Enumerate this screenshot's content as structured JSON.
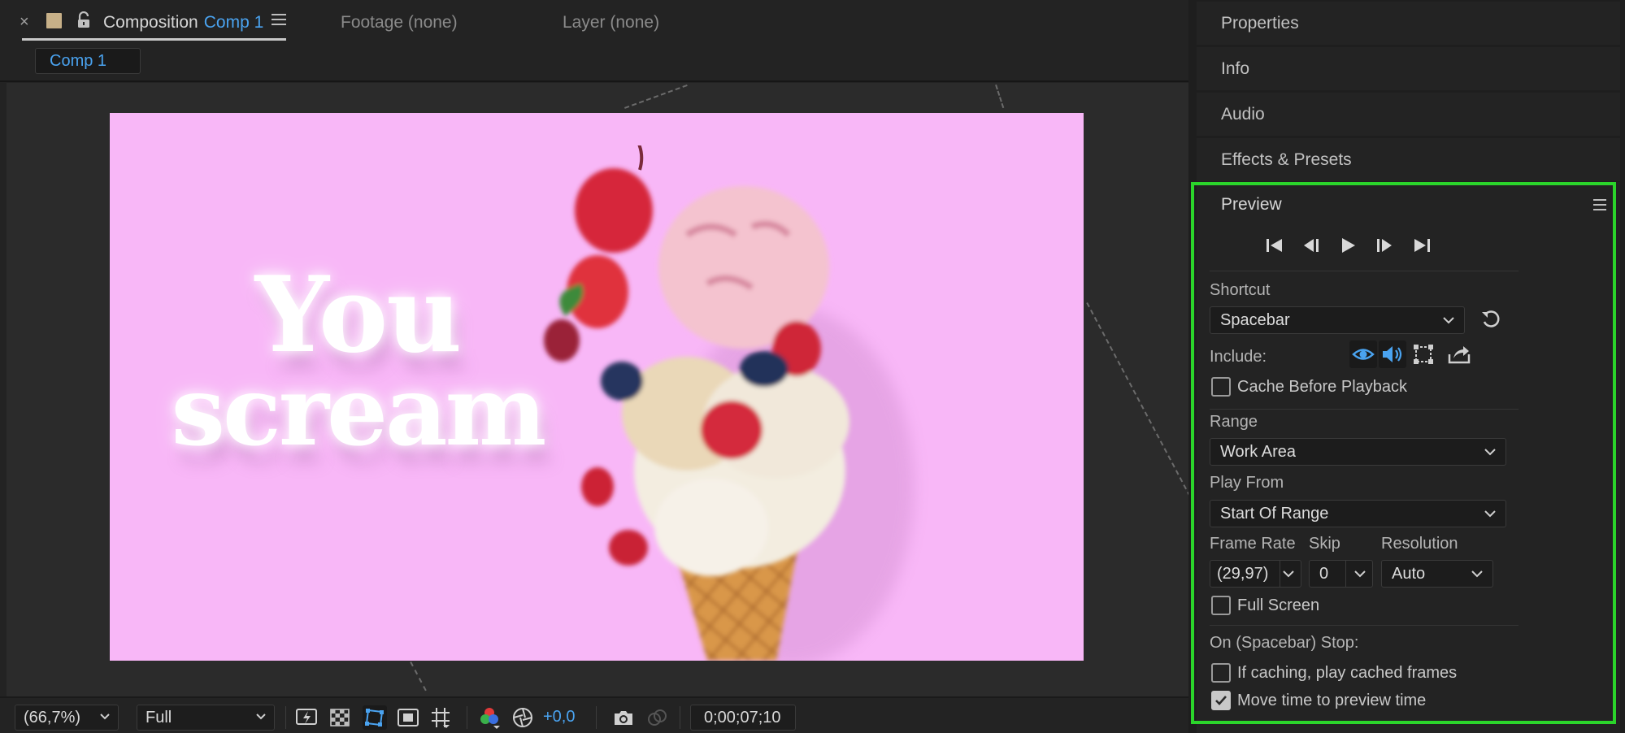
{
  "composition_panel": {
    "tabs": [
      {
        "prefix": "Composition",
        "accent": "Comp 1"
      },
      {
        "label": "Footage (none)"
      },
      {
        "label": "Layer (none)"
      }
    ],
    "breadcrumb": "Comp 1",
    "canvas_text": {
      "line1": "You",
      "line2": "scream"
    },
    "toolbar": {
      "magnification": "(66,7%)",
      "resolution": "Full",
      "exposure": "+0,0",
      "timecode": "0;00;07;10"
    },
    "colors": {
      "accent": "#4aa3f0",
      "canvas_background": "#f8b7f7"
    }
  },
  "right_panels": {
    "collapsed": [
      "Properties",
      "Info",
      "Audio",
      "Effects & Presets"
    ]
  },
  "preview": {
    "title": "Preview",
    "transport_icons": [
      "first-frame-icon",
      "previous-frame-icon",
      "play-icon",
      "next-frame-icon",
      "last-frame-icon"
    ],
    "shortcut_label": "Shortcut",
    "shortcut_value": "Spacebar",
    "include_label": "Include:",
    "include_icons": [
      "video-eye-icon",
      "audio-speaker-icon",
      "overlays-icon",
      "export-icon"
    ],
    "cache_before_playback": {
      "label": "Cache Before Playback",
      "checked": false
    },
    "range_label": "Range",
    "range_value": "Work Area",
    "play_from_label": "Play From",
    "play_from_value": "Start Of Range",
    "frame_rate_label": "Frame Rate",
    "frame_rate_value": "(29,97)",
    "skip_label": "Skip",
    "skip_value": "0",
    "resolution_label": "Resolution",
    "resolution_value": "Auto",
    "full_screen": {
      "label": "Full Screen",
      "checked": false
    },
    "stop_label": "On (Spacebar) Stop:",
    "if_caching": {
      "label": "If caching, play cached frames",
      "checked": false
    },
    "move_time": {
      "label": "Move time to preview time",
      "checked": true
    },
    "highlight_color": "#2bd52b"
  }
}
